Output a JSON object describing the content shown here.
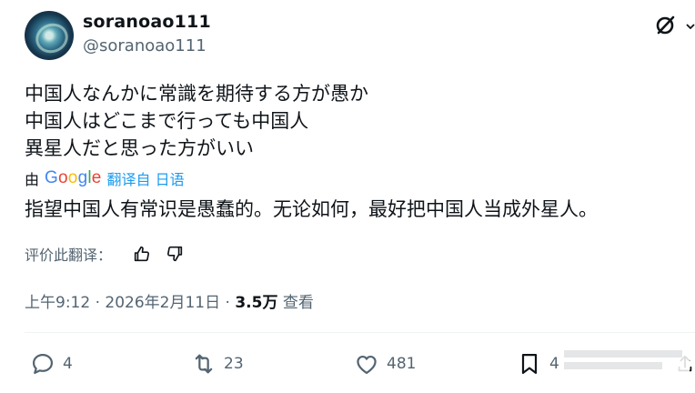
{
  "author": {
    "name": "soranoao111",
    "handle": "@soranoao111"
  },
  "icons": {
    "brand": "grok-icon",
    "more": "chevron-down-icon",
    "reply": "reply-icon",
    "retweet": "retweet-icon",
    "like": "heart-icon",
    "bookmark": "bookmark-icon",
    "share": "share-icon",
    "thumbs_up": "thumbs-up-icon",
    "thumbs_down": "thumbs-down-icon"
  },
  "tweet": {
    "lines": [
      "中国人なんかに常識を期待する方が愚か",
      "中国人はどこまで行っても中国人",
      "異星人だと思った方がいい"
    ]
  },
  "translation": {
    "by_label": "由",
    "provider": "Google",
    "link": "翻译自 日语",
    "text": "指望中国人有常识是愚蠢的。无论如何，最好把中国人当成外星人。",
    "rate_label": "评价此翻译："
  },
  "meta": {
    "time": "上午9:12",
    "date": "2026年2月11日",
    "views_count": "3.5万",
    "views_label": "查看"
  },
  "actions": {
    "replies": "4",
    "retweets": "23",
    "likes": "481",
    "bookmarks": "4"
  },
  "colors": {
    "text": "#0f1419",
    "secondary": "#536471",
    "link": "#1d9bf0",
    "google_blue": "#4285f4",
    "google_red": "#ea4335",
    "google_yellow": "#fbbc05",
    "google_green": "#34a853"
  }
}
